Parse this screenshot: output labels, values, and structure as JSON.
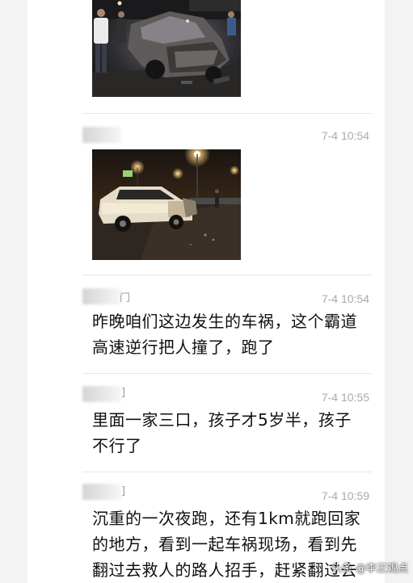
{
  "messages": [
    {
      "time": "",
      "type": "image"
    },
    {
      "sender_tail": "",
      "time": "7-4 10:54",
      "type": "image"
    },
    {
      "sender_tail": "门",
      "time": "7-4 10:54",
      "type": "text",
      "lines": [
        "昨晚咱们这边发生的车祸，这个霸道",
        "高速逆行把人撞了，跑了"
      ]
    },
    {
      "sender_tail": "]",
      "time": "7-4 10:55",
      "type": "text",
      "lines": [
        "里面一家三口，孩子才5岁半，孩子",
        "不行了"
      ]
    },
    {
      "sender_tail": "]",
      "time": "7-4 10:59",
      "type": "text",
      "lines": [
        "沉重的一次夜跑，还有1km就跑回家",
        "的地方，看到一起车祸现场，看到先",
        "翻过去救人的路人招手，赶紧翻过去"
      ]
    }
  ],
  "watermark": "头条 @李正观点",
  "colors": {
    "background": "#f3f3f3",
    "panel": "#ffffff",
    "timestamp": "#aaaaaa",
    "message_text": "#111111"
  }
}
